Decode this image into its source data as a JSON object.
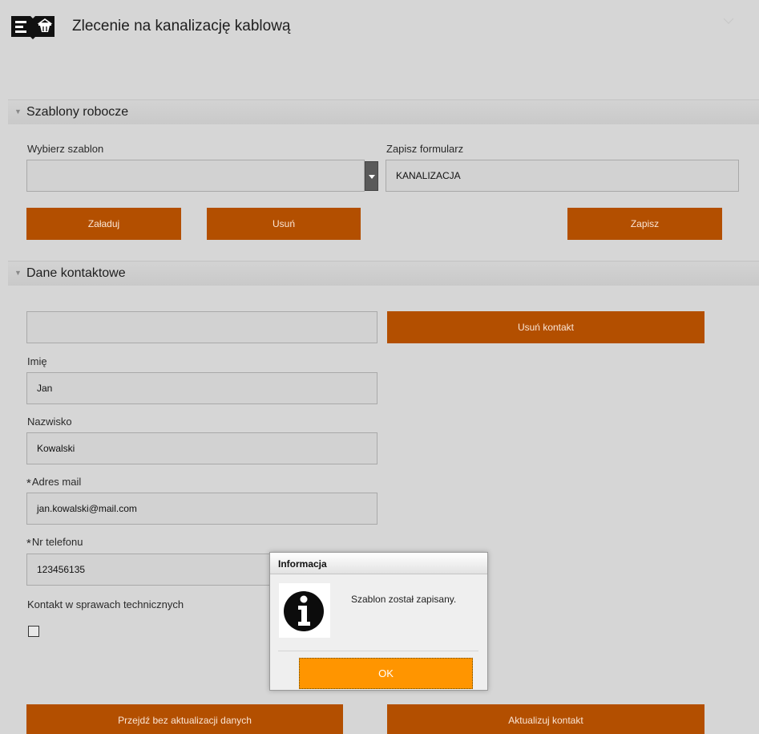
{
  "header": {
    "title": "Zlecenie na kanalizację kablową"
  },
  "sections": {
    "templates": {
      "title": "Szablony robocze",
      "choose_label": "Wybierz szablon",
      "choose_value": "",
      "save_form_label": "Zapisz formularz",
      "save_form_value": "KANALIZACJA",
      "load_button": "Załaduj",
      "delete_button": "Usuń",
      "save_button": "Zapisz"
    },
    "contact": {
      "title": "Dane kontaktowe",
      "contact_select_value": "",
      "remove_contact_button": "Usuń kontakt",
      "first_name_label": "Imię",
      "first_name_value": "Jan",
      "last_name_label": "Nazwisko",
      "last_name_value": "Kowalski",
      "required_mark": "*",
      "email_label": "Adres mail",
      "email_value": "jan.kowalski@mail.com",
      "phone_label": "Nr telefonu",
      "phone_value": "123456135",
      "tech_contact_label": "Kontakt w sprawach technicznych",
      "tech_contact_checked": false,
      "skip_button": "Przejdź bez aktualizacji danych",
      "update_button": "Aktualizuj kontakt"
    }
  },
  "dialog": {
    "title": "Informacja",
    "message": "Szablon został zapisany.",
    "ok_button": "OK",
    "icon": "info-icon"
  },
  "colors": {
    "background": "#d6d6d6",
    "button": "#b34f00",
    "ok_button": "#ff9500"
  }
}
